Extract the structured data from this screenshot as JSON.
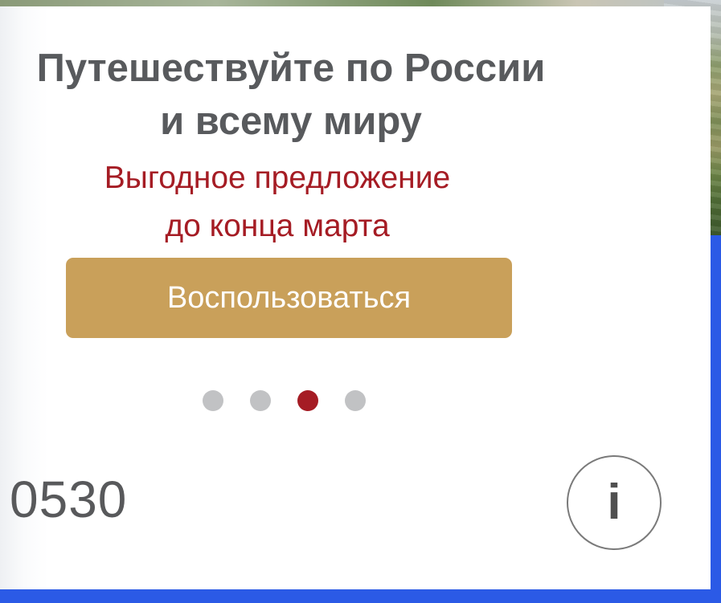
{
  "promo": {
    "headline_line1": "Путешествуйте по России",
    "headline_line2": "и всему миру",
    "offer_line1": "Выгодное предложение",
    "offer_line2": "до конца марта",
    "cta_label": "Воспользоваться"
  },
  "carousel": {
    "slide_count": 4,
    "active_index": 2
  },
  "footer": {
    "code": "0530",
    "info_glyph": "i",
    "info_icon": "info-icon"
  },
  "colors": {
    "headline": "#585a5d",
    "offer": "#a51c24",
    "cta_background": "#c9a05a",
    "dot_inactive": "#c1c2c4",
    "dot_active": "#a51c24",
    "frame_blue": "#2b5ae6"
  }
}
